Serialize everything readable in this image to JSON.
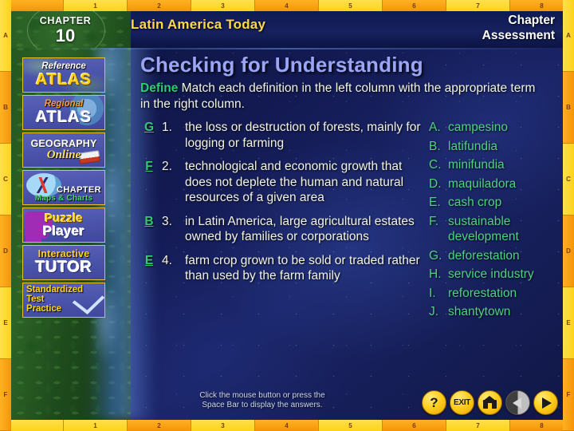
{
  "rulers": {
    "horizontal": [
      "1",
      "2",
      "3",
      "4",
      "5",
      "6",
      "7",
      "8"
    ],
    "vertical": [
      "A",
      "B",
      "C",
      "D",
      "E",
      "F"
    ]
  },
  "header": {
    "chapter_word": "CHAPTER",
    "chapter_number": "10",
    "unit_title": "Latin America Today",
    "section_line1": "Chapter",
    "section_line2": "Assessment"
  },
  "sidebar": {
    "buttons": [
      {
        "name": "reference-atlas",
        "line1": "Reference",
        "line2": "ATLAS",
        "line3": ""
      },
      {
        "name": "regional-atlas",
        "line1": "Regional",
        "line2": "ATLAS",
        "line3": ""
      },
      {
        "name": "geography-online",
        "line1": "GEOGRAPHY",
        "line2": "Online",
        "line3": ""
      },
      {
        "name": "chapter-maps-charts",
        "line1": "CHAPTER",
        "line2": "Maps & Charts",
        "line3": ""
      },
      {
        "name": "puzzle-player",
        "line1": "Puzzle",
        "line2": "Player",
        "line3": ""
      },
      {
        "name": "interactive-tutor",
        "line1": "Interactive",
        "line2": "TUTOR",
        "line3": ""
      },
      {
        "name": "standardized-test-practice",
        "line1": "Standardized",
        "line2": "Test",
        "line3": "Practice"
      }
    ]
  },
  "main": {
    "title": "Checking for Understanding",
    "directions_keyword": "Define",
    "directions_text": "  Match each definition in the left column with the appropriate term in the right column.",
    "questions": [
      {
        "answer": "G",
        "number": "1.",
        "text": "the loss or destruction of forests, mainly for logging or farming"
      },
      {
        "answer": "F",
        "number": "2.",
        "text": "technological and economic growth that does not deplete the human and natural resources of a given area"
      },
      {
        "answer": "B",
        "number": "3.",
        "text": "in Latin America, large agricultural estates owned by families or corporations"
      },
      {
        "answer": "E",
        "number": "4.",
        "text": "farm crop grown to be sold or traded rather than used by the farm family"
      }
    ],
    "terms": [
      {
        "letter": "A.",
        "word": "campesino"
      },
      {
        "letter": "B.",
        "word": "latifundia"
      },
      {
        "letter": "C.",
        "word": "minifundia"
      },
      {
        "letter": "D.",
        "word": "maquiladora"
      },
      {
        "letter": "E.",
        "word": "cash crop"
      },
      {
        "letter": "F.",
        "word": "sustainable development"
      },
      {
        "letter": "G.",
        "word": "deforestation"
      },
      {
        "letter": "H.",
        "word": "service industry"
      },
      {
        "letter": "I.",
        "word": "reforestation"
      },
      {
        "letter": "J.",
        "word": "shantytown"
      }
    ]
  },
  "footer": {
    "hint_line1": "Click the mouse button or press the",
    "hint_line2": "Space Bar to display the answers.",
    "nav_buttons": [
      {
        "name": "help-button",
        "glyph": "?"
      },
      {
        "name": "exit-button",
        "glyph": "EXIT"
      },
      {
        "name": "home-button",
        "glyph": "home-icon"
      },
      {
        "name": "previous-button",
        "glyph": "left-triangle-icon"
      },
      {
        "name": "next-button",
        "glyph": "right-triangle-icon"
      }
    ]
  },
  "colors": {
    "title": "#9aa6f5",
    "keyword_green": "#2ecc71",
    "term_green": "#4fd17f",
    "body_cream": "#f2f4e2",
    "unit_gold": "#ffd84a",
    "ruler_yellow": "#ffd21a",
    "ruler_orange": "#f59408",
    "navy_bg": "#131a52"
  }
}
